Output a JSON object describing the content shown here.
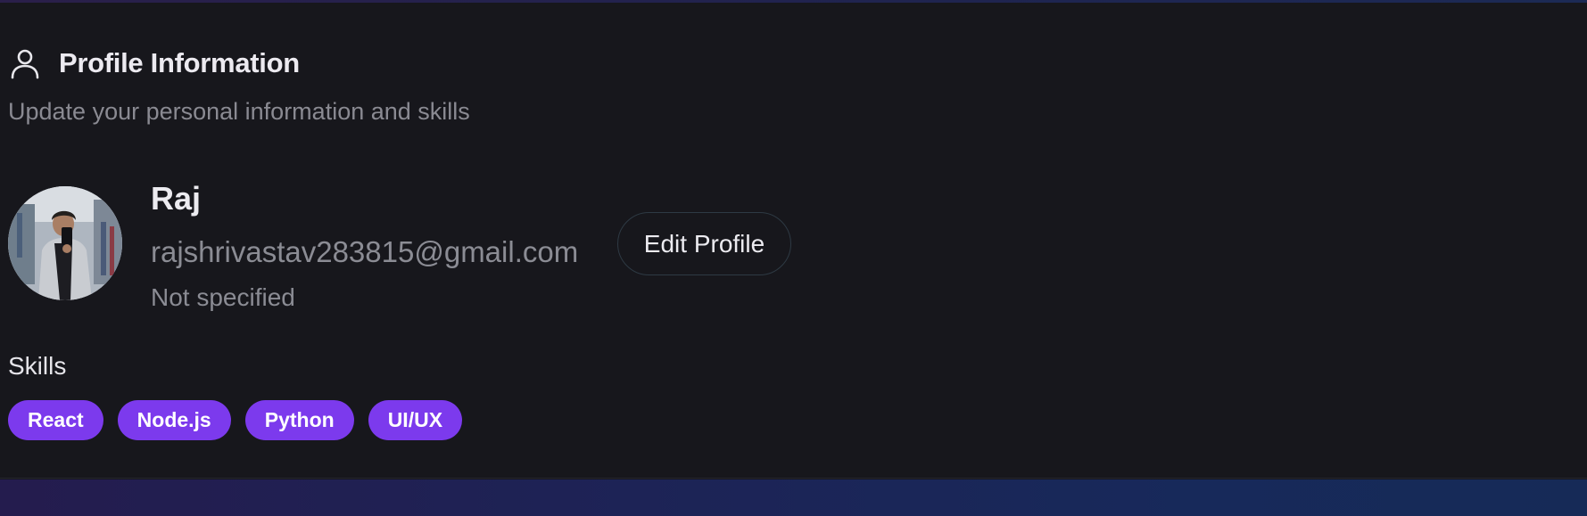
{
  "header": {
    "icon": "user-icon",
    "title": "Profile Information",
    "subtitle": "Update your personal information and skills"
  },
  "profile": {
    "name": "Raj",
    "email": "rajshrivastav283815@gmail.com",
    "status": "Not specified",
    "edit_button_label": "Edit Profile"
  },
  "skills": {
    "label": "Skills",
    "items": [
      "React",
      "Node.js",
      "Python",
      "UI/UX"
    ],
    "chip_color": "#7c3aed"
  },
  "theme": {
    "background": "#17171c",
    "text_primary": "#ecebf0",
    "text_muted": "#8b8c94"
  }
}
